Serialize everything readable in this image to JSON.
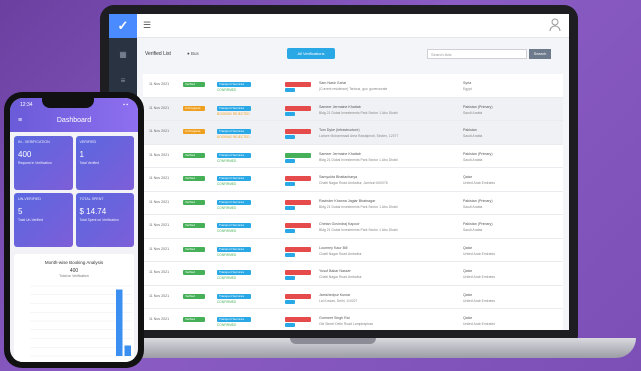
{
  "laptop": {
    "filter": {
      "title": "Verified List",
      "radio": "Bus",
      "dropdown": "All Verifications",
      "search_placeholder": "Search Ads",
      "search_btn": "Search"
    },
    "rows": [
      {
        "date": "11 Nov 2021",
        "status": "Verified",
        "status_color": "#46b058",
        "svc": "Transport Services",
        "svc2": "CONFIRMED",
        "tag_color": "#e54b4b",
        "l1": "Sam Nasir Gahzi",
        "l2": "(Current residence) Tartous, gov. governorate",
        "c1": "Syria",
        "c2": "Egypt"
      },
      {
        "date": "11 Nov 2021",
        "status": "In Progress",
        "status_color": "#f0a020",
        "svc": "Transport Services",
        "svc2": "BOOKING REJECTED",
        "tag_color": "#e54b4b",
        "l1": "Sameer Jermaine Khattab",
        "l2": "Bldg 21 Dubai Investments Park Sector 1 Abu Dhabi",
        "c1": "Pakistan (Primary)",
        "c2": "Saudi Arabia"
      },
      {
        "date": "11 Nov 2021",
        "status": "In Progress",
        "status_color": "#f0a020",
        "svc": "Transport Services",
        "svc2": "BOOKING REJECTED",
        "tag_color": "#e54b4b",
        "l1": "Tom Dyke (Infrastructure)",
        "l2": "Lahore Mohammadi Area Rawalpindi, Sinden, 12077",
        "c1": "Pakistan",
        "c2": "Saudi Arabia"
      },
      {
        "date": "11 Nov 2021",
        "status": "Verified",
        "status_color": "#46b058",
        "svc": "Transport Services",
        "svc2": "CONFIRMED",
        "tag_color": "#46b058",
        "l1": "Sameer Jermaine Khattab",
        "l2": "Bldg 21 Dubai Investments Park Sector 1 Abu Dhabi",
        "c1": "Pakistan (Primary)",
        "c2": "Saudi Arabia"
      },
      {
        "date": "11 Nov 2021",
        "status": "Verified",
        "status_color": "#46b058",
        "svc": "Transport Services",
        "svc2": "CONFIRMED",
        "tag_color": "#e54b4b",
        "l1": "Samyukta Bhattacharya",
        "l2": "Chatti Nagar Road Ambattur, Jamhuri 600078",
        "c1": "Qatar",
        "c2": "United Arab Emirates"
      },
      {
        "date": "11 Nov 2021",
        "status": "Verified",
        "status_color": "#46b058",
        "svc": "Transport Services",
        "svc2": "CONFIRMED",
        "tag_color": "#e54b4b",
        "l1": "Ravinder Khanna Jagtar Bhatnagar",
        "l2": "Bldg 21 Dubai Investments Park Sector 1 Abu Dhabi",
        "c1": "Pakistan (Primary)",
        "c2": "Saudi Arabia"
      },
      {
        "date": "11 Nov 2021",
        "status": "Verified",
        "status_color": "#46b058",
        "svc": "Transport Services",
        "svc2": "CONFIRMED",
        "tag_color": "#e54b4b",
        "l1": "Chetan Govindraj Kapoor",
        "l2": "Bldg 21 Dubai Investments Park Sector 1 Abu Dhabi",
        "c1": "Pakistan (Primary)",
        "c2": "Saudi Arabia"
      },
      {
        "date": "11 Nov 2021",
        "status": "Verified",
        "status_color": "#46b058",
        "svc": "Transport Services",
        "svc2": "CONFIRMED",
        "tag_color": "#e54b4b",
        "l1": "Lourmey Kaur Bill",
        "l2": "Chatti Nagar Road Ambattur",
        "c1": "Qatar",
        "c2": "United Arab Emirates"
      },
      {
        "date": "11 Nov 2021",
        "status": "Verified",
        "status_color": "#46b058",
        "svc": "Transport Services",
        "svc2": "CONFIRMED",
        "tag_color": "#e54b4b",
        "l1": "Yusuf Bakar Nasser",
        "l2": "Chatti Nagar Road Ambattur",
        "c1": "Qatar",
        "c2": "United Arab Emirates"
      },
      {
        "date": "11 Nov 2021",
        "status": "Verified",
        "status_color": "#46b058",
        "svc": "Transport Services",
        "svc2": "CONFIRMED",
        "tag_color": "#e54b4b",
        "l1": "Jamshedpur Kumar",
        "l2": "Lal Kuwan, Delhi, 110027",
        "c1": "Qatar",
        "c2": "United Arab Emirates"
      },
      {
        "date": "11 Nov 2021",
        "status": "Verified",
        "status_color": "#46b058",
        "svc": "Transport Services",
        "svc2": "CONFIRMED",
        "tag_color": "#e54b4b",
        "l1": "Gurmeet Singh Rai",
        "l2": "Old Street Delhi Road Lamptraphaa",
        "c1": "Qatar",
        "c2": "United Arab Emirates"
      }
    ]
  },
  "phone": {
    "time": "12:34",
    "status": "▪ ▪",
    "title": "Dashboard",
    "cards": [
      {
        "title": "IN - VERIFICATION",
        "value": "400",
        "sub": "Request in Verification"
      },
      {
        "title": "VERIFIED",
        "value": "1",
        "sub": "Total Verified"
      },
      {
        "title": "UN-VERIFIED",
        "value": "5",
        "sub": "Total Un-Verified"
      },
      {
        "title": "TOTAL SPENT",
        "value": "$ 14.74",
        "sub": "Total Spent on Verification"
      }
    ],
    "chart": {
      "title": "Month-wise Booking Analysis",
      "value": "400",
      "sub": "Total on Verification"
    }
  },
  "chart_data": {
    "type": "bar",
    "categories": [
      "1",
      "2",
      "3",
      "4",
      "5",
      "6",
      "7",
      "8",
      "9",
      "10",
      "11",
      "12"
    ],
    "values": [
      0,
      0,
      0,
      0,
      0,
      0,
      0,
      0,
      0,
      0,
      380,
      60
    ],
    "ylim": [
      0,
      400
    ]
  }
}
